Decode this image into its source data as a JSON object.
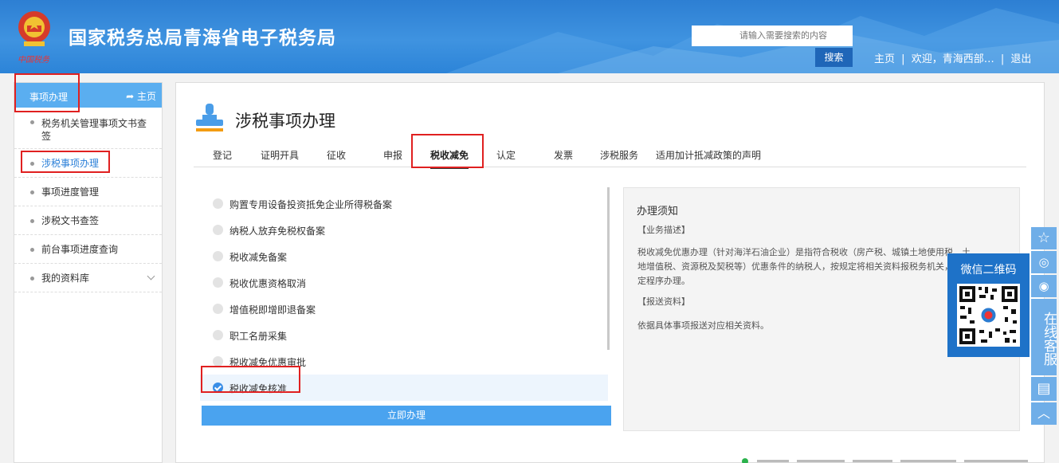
{
  "header": {
    "site_title": "国家税务总局青海省电子税务局",
    "slogan": "中国税务",
    "search_placeholder": "请输入需要搜索的内容",
    "search_button": "搜索",
    "links": {
      "home": "主页",
      "sep": "|",
      "welcome": "欢迎，青海西部… ",
      "logout": "退出"
    }
  },
  "sidebar": {
    "title": "事项办理",
    "home": "主页",
    "items": [
      {
        "label": "税务机关管理事项文书查签"
      },
      {
        "label": "涉税事项办理"
      },
      {
        "label": "事项进度管理"
      },
      {
        "label": "涉税文书查签"
      },
      {
        "label": "前台事项进度查询"
      },
      {
        "label": "我的资料库"
      }
    ]
  },
  "main": {
    "title": "涉税事项办理",
    "tabs": [
      {
        "label": "登记"
      },
      {
        "label": "证明开具"
      },
      {
        "label": "征收"
      },
      {
        "label": "申报"
      },
      {
        "label": "税收减免"
      },
      {
        "label": "认定"
      },
      {
        "label": "发票"
      },
      {
        "label": "涉税服务"
      },
      {
        "label": "适用加计抵减政策的声明"
      }
    ],
    "active_tab": "税收减免",
    "options": [
      {
        "label": "购置专用设备投资抵免企业所得税备案"
      },
      {
        "label": "纳税人放弃免税权备案"
      },
      {
        "label": "税收减免备案"
      },
      {
        "label": "税收优惠资格取消"
      },
      {
        "label": "增值税即增即退备案"
      },
      {
        "label": "职工名册采集"
      },
      {
        "label": "税收减免优惠审批"
      },
      {
        "label": "税收减免核准"
      }
    ],
    "selected_option": "税收减免核准",
    "submit_button": "立即办理",
    "notice": {
      "heading": "办理须知",
      "section1_title": "【业务描述】",
      "section1_body": "税收减免优惠办理（针对海洋石油企业）是指符合税收（房产税、城镇土地使用税、土地增值税、资源税及契税等）优惠条件的纳税人，按规定将相关资料报税务机关，依规定程序办理。",
      "section2_title": "【报送资料】",
      "section2_body": "依据具体事项报送对应相关资料。"
    }
  },
  "float": {
    "service_text": "在线客服",
    "wechat_caption": "微信二维码"
  },
  "colors": {
    "header": "#2f84d6",
    "accent": "#4aa3ef",
    "highlight": "#e02020"
  }
}
